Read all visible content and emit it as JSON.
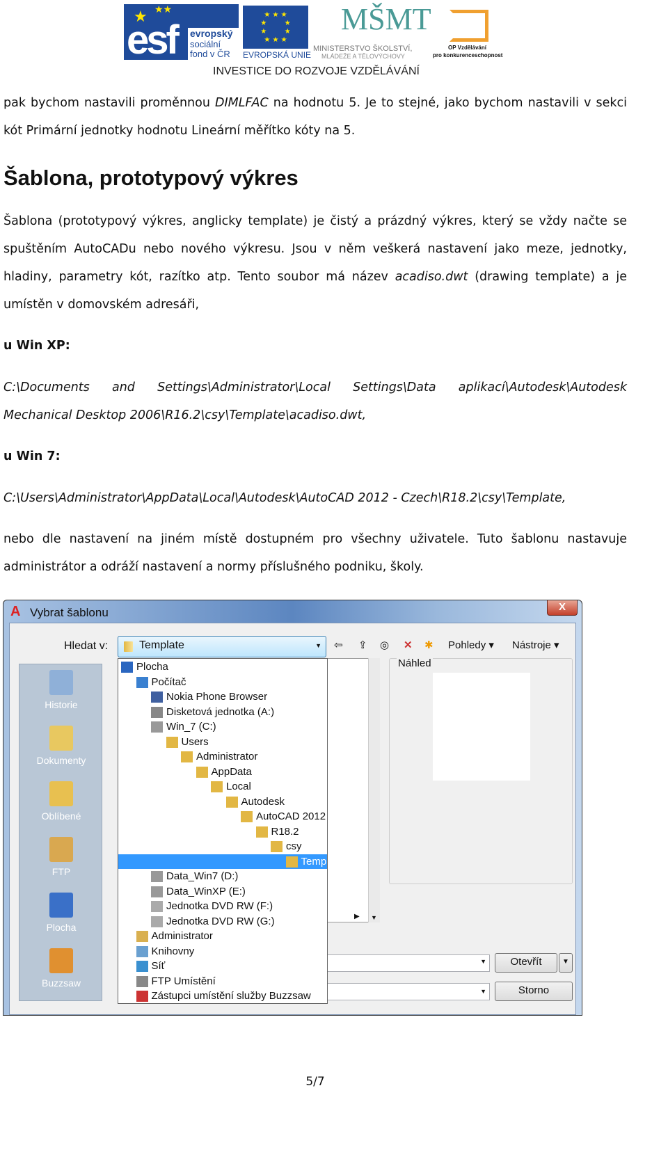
{
  "header": {
    "esf_line1": "evropský",
    "esf_line2": "sociální",
    "esf_line3": "fond v ČR",
    "eu": "EVROPSKÁ UNIE",
    "msmt_line1": "MINISTERSTVO ŠKOLSTVÍ,",
    "msmt_line2": "MLÁDEŽE A TĚLOVÝCHOVY",
    "op_line1": "OP Vzdělávání",
    "op_line2": "pro konkurenceschopnost",
    "tagline": "INVESTICE DO ROZVOJE VZDĚLÁVÁNÍ",
    "logo_esf": "esf",
    "logo_msmt": "MŠMT"
  },
  "intro": {
    "l1a": "pak bychom nastavili proměnnou ",
    "l1b": "DIMLFAC",
    "l1c": " na hodnotu 5. Je to stejné, jako bychom nastavili v sekci",
    "l2": "kót Primární jednotky hodnotu Lineární měřítko kóty na 5."
  },
  "heading": "Šablona, prototypový výkres",
  "para1": {
    "l1": "Šablona (prototypový výkres, anglicky template) je čistý a prázdný výkres, který se vždy načte se",
    "l2": "spuštěním AutoCADu nebo nového výkresu. Jsou v něm veškerá nastavení jako meze, jednotky,",
    "l3a": "hladiny, parametry kót, razítko atp. Tento soubor má název ",
    "l3b": "acadiso.dwt",
    "l3c": " (drawing template) a je",
    "l4": "umístěn v domovském adresáři,"
  },
  "xp": {
    "label": "u Win XP:",
    "path1": "C:\\Documents and Settings\\Administrator\\Local Settings\\Data aplikací\\Autodesk\\Autodesk",
    "path2": "Mechanical Desktop 2006\\R16.2\\csy\\Template\\acadiso.dwt,"
  },
  "w7": {
    "label": "u Win 7:",
    "path": "C:\\Users\\Administrator\\AppData\\Local\\Autodesk\\AutoCAD 2012 - Czech\\R18.2\\csy\\Template,"
  },
  "para2": {
    "l1": "nebo dle nastavení na jiném místě dostupném pro všechny uživatele. Tuto šablonu nastavuje",
    "l2": "administrátor a odráží nastavení a normy příslušného podniku, školy."
  },
  "dialog": {
    "title": "Vybrat šablonu",
    "close": "X",
    "lookin_label": "Hledat v:",
    "lookin_value": "Template",
    "toolbar": {
      "views": "Pohledy",
      "tools": "Nástroje"
    },
    "preview_label": "Náhled",
    "open": "Otevřít",
    "cancel": "Storno",
    "places": [
      "Historie",
      "Dokumenty",
      "Oblíbené",
      "FTP",
      "Plocha",
      "Buzzsaw"
    ],
    "tree": [
      {
        "label": "Plocha",
        "level": 0,
        "icon": "desktop-icon"
      },
      {
        "label": "Počítač",
        "level": 1,
        "icon": "computer-icon"
      },
      {
        "label": "Nokia Phone Browser",
        "level": 2,
        "icon": "phone-icon"
      },
      {
        "label": "Disketová jednotka (A:)",
        "level": 2,
        "icon": "floppy-icon"
      },
      {
        "label": "Win_7 (C:)",
        "level": 2,
        "icon": "drive-icon"
      },
      {
        "label": "Users",
        "level": 3,
        "icon": "folder-icon"
      },
      {
        "label": "Administrator",
        "level": 4,
        "icon": "folder-icon"
      },
      {
        "label": "AppData",
        "level": 5,
        "icon": "folder-icon"
      },
      {
        "label": "Local",
        "level": 6,
        "icon": "folder-icon"
      },
      {
        "label": "Autodesk",
        "level": 7,
        "icon": "folder-icon"
      },
      {
        "label": "AutoCAD 2012",
        "level": 8,
        "icon": "folder-icon"
      },
      {
        "label": "R18.2",
        "level": 9,
        "icon": "folder-icon"
      },
      {
        "label": "csy",
        "level": 10,
        "icon": "folder-icon"
      },
      {
        "label": "Temp",
        "level": 11,
        "icon": "folder-icon",
        "selected": true
      },
      {
        "label": "Data_Win7 (D:)",
        "level": 2,
        "icon": "drive-icon"
      },
      {
        "label": "Data_WinXP (E:)",
        "level": 2,
        "icon": "drive-icon"
      },
      {
        "label": "Jednotka DVD RW (F:)",
        "level": 2,
        "icon": "dvd-icon"
      },
      {
        "label": "Jednotka DVD RW (G:)",
        "level": 2,
        "icon": "dvd-icon"
      },
      {
        "label": "Administrator",
        "level": 1,
        "icon": "user-folder-icon"
      },
      {
        "label": "Knihovny",
        "level": 1,
        "icon": "library-icon"
      },
      {
        "label": "Síť",
        "level": 1,
        "icon": "network-icon"
      },
      {
        "label": "FTP Umístění",
        "level": 1,
        "icon": "ftp-icon"
      },
      {
        "label": "Zástupci umístění služby Buzzsaw",
        "level": 1,
        "icon": "buzzsaw-icon"
      }
    ]
  },
  "page_number": "5/7",
  "colors": {
    "selection": "#3399ff",
    "titlebar": "#5c86c0",
    "places_bar": "#b9c7d6",
    "folder": "#e2b744"
  }
}
